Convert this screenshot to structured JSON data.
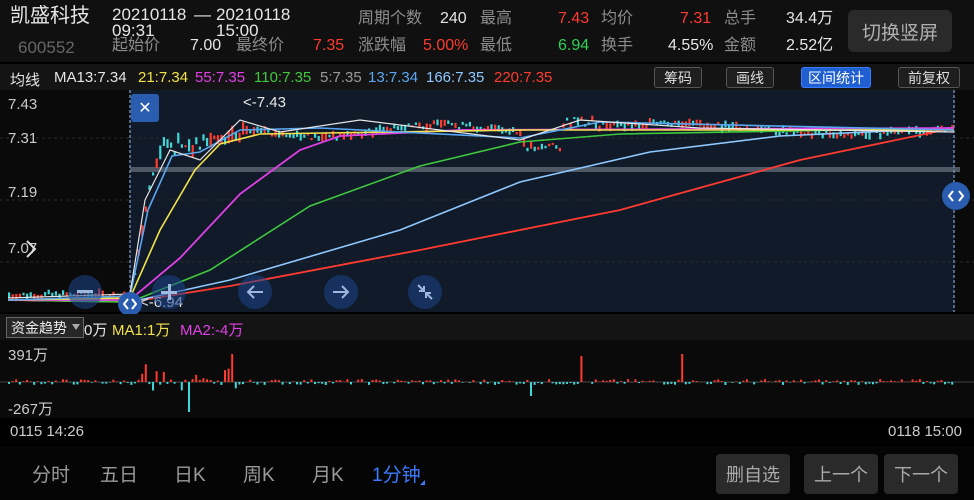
{
  "header": {
    "stock_name": "凯盛科技",
    "stock_code": "600552",
    "range_start_date": "20210118",
    "range_start_time": "09:31",
    "range_dash": "—",
    "range_end_date": "20210118",
    "range_end_time": "15:00",
    "start_price_label": "起始价",
    "start_price_value": "7.00",
    "end_price_label": "最终价",
    "end_price_value": "7.35",
    "stats": [
      {
        "label": "周期个数",
        "value": "240",
        "color": "white"
      },
      {
        "label": "最高",
        "value": "7.43",
        "color": "red"
      },
      {
        "label": "均价",
        "value": "7.31",
        "color": "red"
      },
      {
        "label": "总手",
        "value": "34.4万",
        "color": "white"
      },
      {
        "label": "涨跌幅",
        "value": "5.00%",
        "color": "red"
      },
      {
        "label": "最低",
        "value": "6.94",
        "color": "green"
      },
      {
        "label": "换手",
        "value": "4.55%",
        "color": "white"
      },
      {
        "label": "金额",
        "value": "2.52亿",
        "color": "white"
      }
    ],
    "switch_button": "切换竖屏"
  },
  "ma_bar": {
    "title": "均线",
    "items": [
      {
        "text": "MA13:7.34",
        "color": "#e6e6e6"
      },
      {
        "text": "21:7.34",
        "color": "#f2e24b"
      },
      {
        "text": "55:7.35",
        "color": "#e040e6"
      },
      {
        "text": "110:7.35",
        "color": "#3fc83f"
      },
      {
        "text": "5:7.35",
        "color": "#9a9a9a"
      },
      {
        "text": "13:7.34",
        "color": "#5aa6f0"
      },
      {
        "text": "166:7.35",
        "color": "#8fc8ff"
      },
      {
        "text": "220:7.35",
        "color": "#ff3b30"
      }
    ],
    "buttons": {
      "chip": "筹码",
      "draw": "画线",
      "range": "区间统计",
      "adjust": "前复权"
    }
  },
  "main_chart": {
    "y_labels": [
      "7.43",
      "7.31",
      "7.19",
      "7.07"
    ],
    "high_marker": "<-7.43",
    "low_marker": "<-6.94",
    "close_icon": "✕"
  },
  "fund_bar": {
    "selector": "资金趋势",
    "value": "0万",
    "ma1": "MA1:1万",
    "ma2": "MA2:-4万"
  },
  "fund_chart": {
    "top_label": "391万",
    "bottom_label": "-267万"
  },
  "time_axis": {
    "start": "0115 14:26",
    "end": "0118 15:00"
  },
  "bottom_tabs": {
    "tabs": [
      "分时",
      "五日",
      "日K",
      "周K",
      "月K",
      "1分钟"
    ],
    "buttons": {
      "delete": "删自选",
      "prev": "上一个",
      "next": "下一个"
    }
  },
  "colors": {
    "up": "#ff3b30",
    "down": "#30d158",
    "accent": "#3a7cff",
    "ma13": "#e6e6e6",
    "ma21": "#f2e24b",
    "ma55": "#e040e6",
    "ma110": "#3fc83f",
    "ma13b": "#5aa6f0",
    "ma166": "#8fc8ff",
    "ma220": "#ff3b30"
  }
}
